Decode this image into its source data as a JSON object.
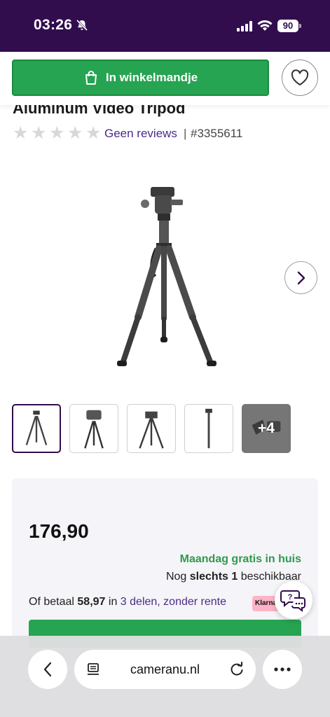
{
  "status_bar": {
    "time": "03:26",
    "battery": "90"
  },
  "product_bar": {
    "cart_button_label": "In winkelmandje",
    "cart_icon": "shopping-bag-icon",
    "wishlist_icon": "heart-icon"
  },
  "product": {
    "title": "Aluminum Video Tripod",
    "rating": 0,
    "rating_max": 5,
    "reviews_label": "Geen reviews",
    "separator": "|",
    "sku": "#3355611"
  },
  "gallery": {
    "next_icon": "chevron-right-icon",
    "more_label": "+4"
  },
  "pricing": {
    "price": "176,90",
    "delivery": "Maandag gratis in huis",
    "stock_prefix": "Nog",
    "stock_bold": "slechts 1",
    "stock_suffix": "beschikbaar",
    "installment_prefix": "Of betaal",
    "installment_amount": "58,97",
    "installment_in": "in",
    "installment_link": "3 delen, zonder rente",
    "klarna_label": "Klarna"
  },
  "browser": {
    "url": "cameranu.nl",
    "back_icon": "chevron-left-icon",
    "tab_icon": "page-icon",
    "reload_icon": "reload-icon",
    "menu_icon": "more-dots-icon"
  },
  "colors": {
    "brand_purple": "#310d4e",
    "cta_green": "#26a451",
    "link_purple": "#4b2c87"
  }
}
